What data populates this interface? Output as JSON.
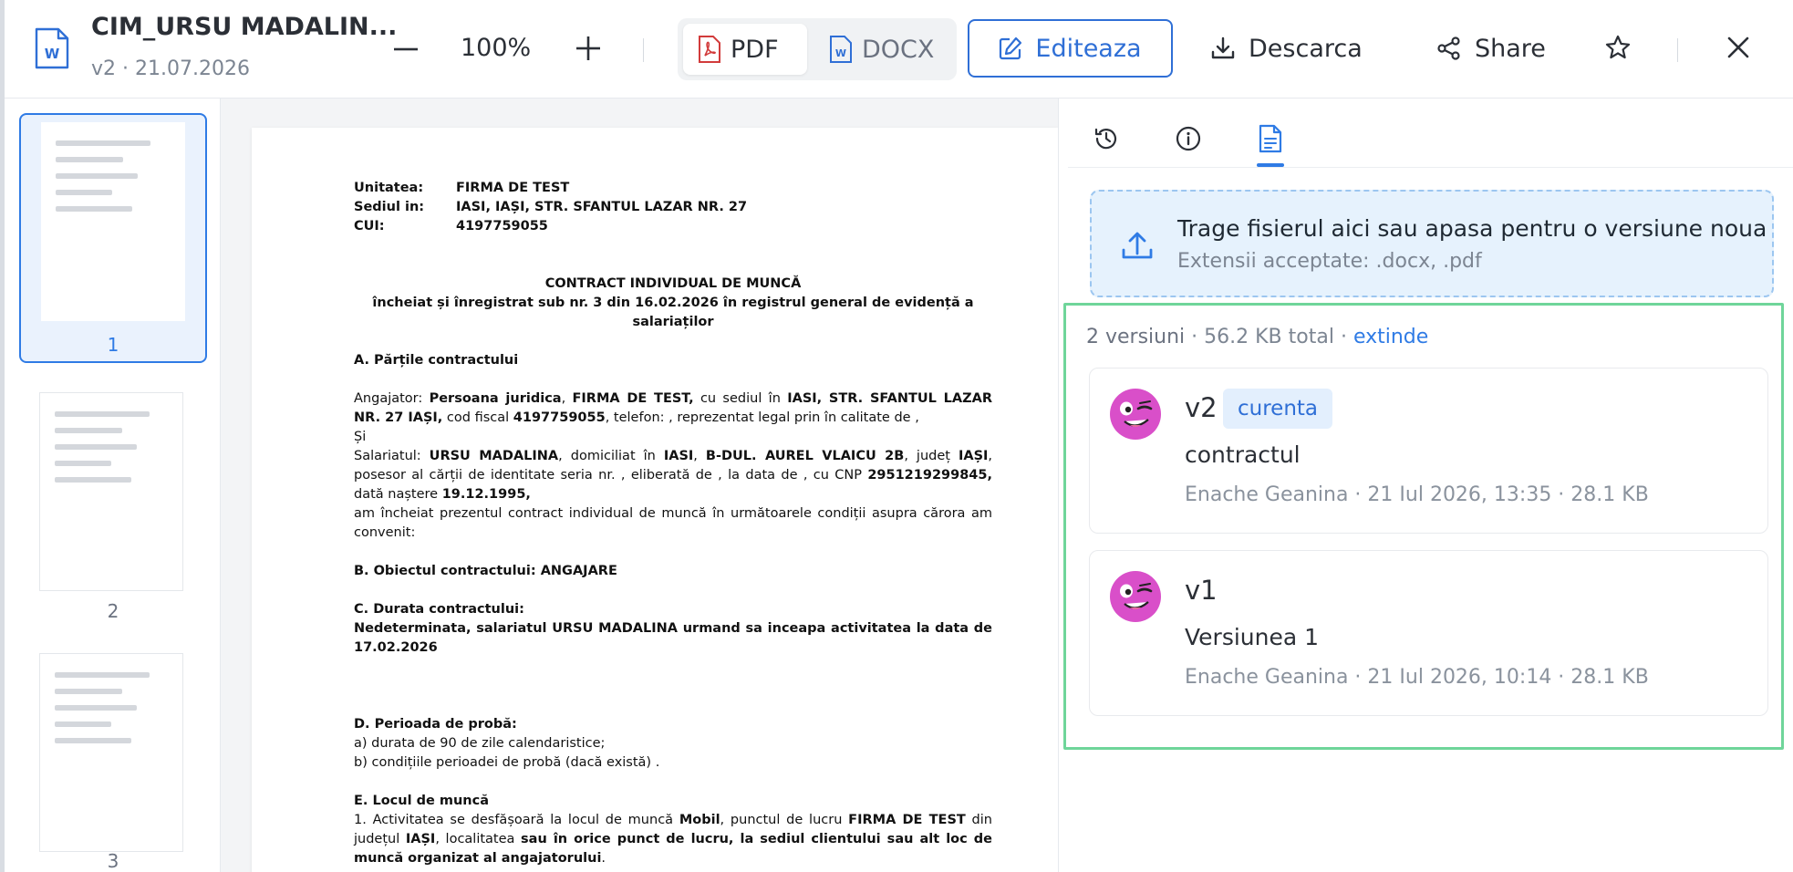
{
  "header": {
    "title": "CIM_URSU MADALIN...",
    "subtitle": "v2 · 21.07.2026",
    "zoom": "100%",
    "format_pdf": "PDF",
    "format_docx": "DOCX",
    "edit_label": "Editeaza",
    "download_label": "Descarca",
    "share_label": "Share"
  },
  "thumbnails": [
    {
      "label": "1",
      "active": true
    },
    {
      "label": "2",
      "active": false
    },
    {
      "label": "3",
      "active": false
    }
  ],
  "document": {
    "unit_label": "Unitatea:",
    "unit_value": "FIRMA DE TEST",
    "seat_label": "Sediul in:",
    "seat_value": "IASI, IAȘI, STR. SFANTUL LAZAR NR. 27",
    "cui_label": "CUI:",
    "cui_value": "4197759055",
    "heading1": "CONTRACT INDIVIDUAL DE MUNCĂ",
    "heading2": "încheiat și înregistrat sub nr. 3 din 16.02.2026 în registrul general de evidență a salariaților",
    "sectionA": "A. Părțile contractului",
    "employer_intro": "Angajator:",
    "employer_type": "Persoana juridica",
    "employer_name": "FIRMA DE TEST,",
    "employer_mid": " cu sediul în ",
    "employer_addr": "IASI, STR. SFANTUL LAZAR NR. 27 IAȘI,",
    "employer_fiscal": " cod fiscal ",
    "employer_cui": "4197759055",
    "employer_tail": ", telefon: , reprezentat legal prin  în calitate de ,",
    "and": "Și",
    "employee_intro": "Salariatul: ",
    "employee_name": "URSU MADALINA",
    "employee_mid": ", domiciliat în ",
    "employee_city": "IASI",
    "employee_addr_sep": ", ",
    "employee_addr": "B-DUL. AUREL VLAICU 2B",
    "employee_county_pre": ", județ ",
    "employee_county": "IAȘI",
    "employee_tail1": ", posesor al cărții de identitate seria  nr. , eliberată de , la data de , cu CNP ",
    "employee_cnp": "2951219299845,",
    "employee_tail2": " dată naștere ",
    "employee_dob": "19.12.1995,",
    "agreement": "am încheiat prezentul contract individual de muncă în următoarele condiții asupra cărora am convenit:",
    "sectionB": "B. Obiectul contractului: ANGAJARE",
    "sectionC": "C.  Durata contractului:",
    "duration": "Nedeterminata, salariatul URSU MADALINA urmand sa inceapa activitatea la data de 17.02.2026",
    "sectionD": "D. Perioada de probă:",
    "probation_a": "a) durata de 90 de  zile calendaristice;",
    "probation_b": "b) condițiile perioadei de probă (dacă există) .",
    "sectionE": "E. Locul de muncă",
    "workplace_pre": "1. Activitatea se desfășoară la locul de muncă ",
    "workplace_mobile": "Mobil",
    "workplace_mid": ", punctul de lucru ",
    "workplace_firm": "FIRMA DE TEST",
    "workplace_mid2": " din județul ",
    "workplace_county": "IAȘI",
    "workplace_mid3": ", localitatea  ",
    "workplace_tail": "sau în orice punct de lucru, la sediul clientului sau alt loc de muncă organizat al angajatorului",
    "workplace_end": "."
  },
  "panel": {
    "upload_title": "Trage fisierul aici sau apasa pentru o versiune noua",
    "upload_sub": "Extensii acceptate: .docx, .pdf",
    "summary_count": "2 versiuni",
    "summary_size": " · 56.2 KB total · ",
    "summary_expand": "extinde",
    "versions": [
      {
        "name": "v2",
        "badge": "curenta",
        "desc": "contractul",
        "meta": "Enache Geanina · 21 Iul 2026, 13:35 · 28.1 KB"
      },
      {
        "name": "v1",
        "badge": "",
        "desc": "Versiunea 1",
        "meta": "Enache Geanina · 21 Iul 2026, 10:14 · 28.1 KB"
      }
    ]
  },
  "colors": {
    "accent": "#2f7be5",
    "pdf_red": "#d23b3b",
    "docx_blue": "#2f6fd6",
    "highlight_green": "#6fd59a",
    "avatar": "#d94fc9"
  },
  "icons": [
    "word-doc-icon",
    "minus-icon",
    "plus-icon",
    "pdf-icon",
    "docx-icon",
    "edit-icon",
    "download-icon",
    "share-icon",
    "star-icon",
    "close-icon",
    "history-icon",
    "info-icon",
    "document-icon",
    "upload-icon",
    "avatar-icon"
  ]
}
